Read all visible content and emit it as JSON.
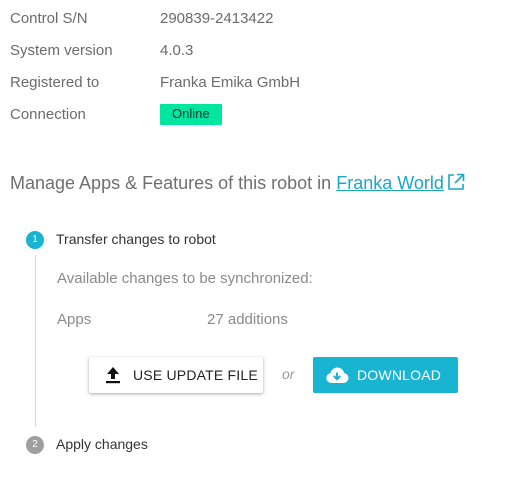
{
  "info": {
    "serial": {
      "label": "Control S/N",
      "value": "290839-2413422"
    },
    "system_version": {
      "label": "System version",
      "value": "4.0.3"
    },
    "registered": {
      "label": "Registered to",
      "value": "Franka Emika GmbH"
    },
    "connection": {
      "label": "Connection",
      "status": "Online",
      "status_color": "#00e5a0"
    }
  },
  "manage": {
    "text": "Manage Apps & Features of this robot in ",
    "link_text": "Franka World",
    "link_color": "#19a7c9"
  },
  "steps": [
    {
      "number": "1",
      "label": "Transfer changes to robot",
      "active": true,
      "color": "#19b4d2"
    },
    {
      "number": "2",
      "label": "Apply changes",
      "active": false,
      "color": "#9e9e9e"
    }
  ],
  "transfer": {
    "available_text": "Available changes to be synchronized:",
    "apps_label": "Apps",
    "apps_value": "27 additions",
    "use_update_file_label": "USE UPDATE FILE",
    "or_text": "or",
    "download_label": "DOWNLOAD"
  },
  "icons": {
    "external_link": "external-link-icon",
    "upload": "upload-icon",
    "cloud_download": "cloud-download-icon"
  }
}
